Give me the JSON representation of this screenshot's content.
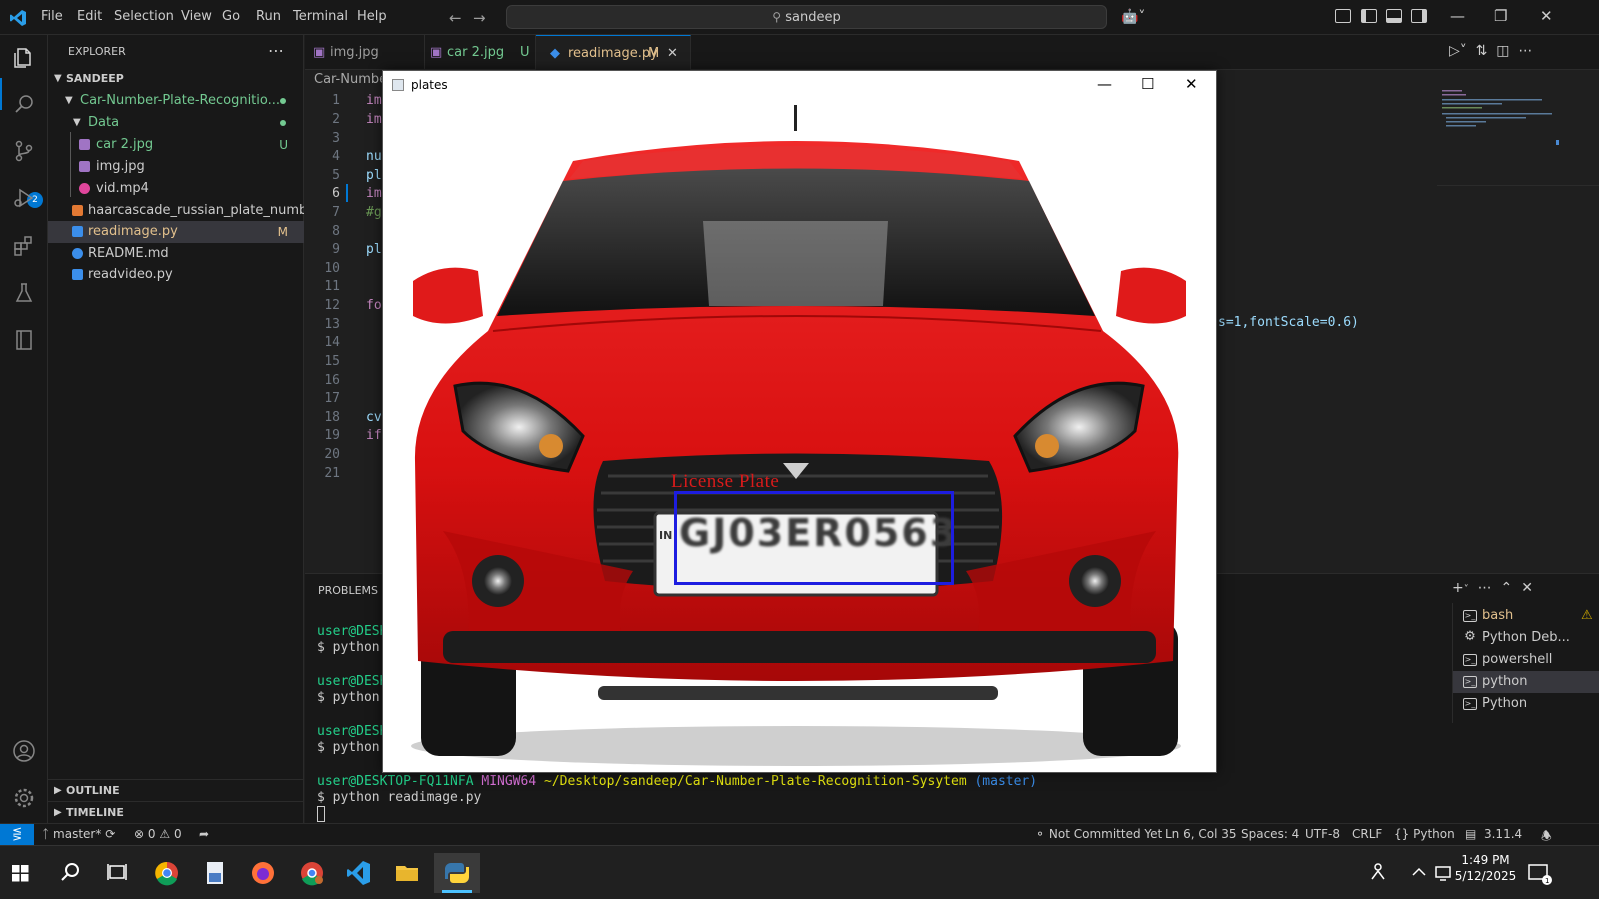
{
  "menu": [
    "File",
    "Edit",
    "Selection",
    "View",
    "Go",
    "Run",
    "Terminal",
    "Help"
  ],
  "search": {
    "text": "sandeep"
  },
  "explorer": {
    "title": "EXPLORER",
    "root": "SANDEEP",
    "folder": "Car-Number-Plate-Recognitio...",
    "subfolder": "Data",
    "files": [
      {
        "name": "car 2.jpg",
        "decoration": "U"
      },
      {
        "name": "img.jpg",
        "decoration": ""
      },
      {
        "name": "vid.mp4",
        "decoration": ""
      },
      {
        "name": "haarcascade_russian_plate_number....",
        "decoration": ""
      },
      {
        "name": "readimage.py",
        "decoration": "M"
      },
      {
        "name": "README.md",
        "decoration": ""
      },
      {
        "name": "readvideo.py",
        "decoration": ""
      }
    ],
    "outline": "OUTLINE",
    "timeline": "TIMELINE"
  },
  "scm_badge": "2",
  "tabs": [
    {
      "label": "img.jpg",
      "dec": ""
    },
    {
      "label": "car 2.jpg",
      "dec": "U"
    },
    {
      "label": "readimage.py",
      "dec": "M"
    }
  ],
  "breadcrumb": "Car-Numbe",
  "code_lines": [
    {
      "n": "1",
      "t": "im"
    },
    {
      "n": "2",
      "t": "im"
    },
    {
      "n": "3",
      "t": ""
    },
    {
      "n": "4",
      "t": "nu"
    },
    {
      "n": "5",
      "t": "pl"
    },
    {
      "n": "6",
      "t": "im"
    },
    {
      "n": "7",
      "t": "#g"
    },
    {
      "n": "8",
      "t": ""
    },
    {
      "n": "9",
      "t": "pl"
    },
    {
      "n": "10",
      "t": ""
    },
    {
      "n": "11",
      "t": ""
    },
    {
      "n": "12",
      "t": "fo"
    },
    {
      "n": "13",
      "t": ""
    },
    {
      "n": "14",
      "t": ""
    },
    {
      "n": "15",
      "t": ""
    },
    {
      "n": "16",
      "t": ""
    },
    {
      "n": "17",
      "t": ""
    },
    {
      "n": "18",
      "t": "cv"
    },
    {
      "n": "19",
      "t": "if"
    },
    {
      "n": "20",
      "t": ""
    },
    {
      "n": "21",
      "t": ""
    }
  ],
  "code_fragment": "s=1,fontScale=0.6)",
  "panel": {
    "title": "PROBLEMS",
    "terminal_lines": [
      {
        "user": "user@DESK",
        "cmd": "$ python r"
      },
      {
        "user": "user@DESK",
        "cmd": "$ python r"
      },
      {
        "user": "user@DESK",
        "cmd": "$ python r"
      }
    ],
    "prompt_user": "user@DESKTOP-FQ11NFA",
    "prompt_shell": "MINGW64",
    "prompt_path": "~/Desktop/sandeep/Car-Number-Plate-Recognition-Sysytem",
    "prompt_branch": "(master)",
    "last_cmd": "$ python readimage.py",
    "terminals": [
      "bash",
      "Python Deb...",
      "powershell",
      "python",
      "Python"
    ]
  },
  "status": {
    "branch": "master*",
    "errors": "0",
    "warnings": "0",
    "commit": "Not Committed Yet",
    "position": "Ln 6, Col 35",
    "spaces": "Spaces: 4",
    "encoding": "UTF-8",
    "eol": "CRLF",
    "language": "Python",
    "version": "3.11.4"
  },
  "plates_window": {
    "title": "plates",
    "label": "License Plate",
    "plate": "GJ03ER0563",
    "plate_side": "IN"
  },
  "clock": {
    "time": "1:49 PM",
    "date": "5/12/2025"
  },
  "colors": {
    "accent": "#0078d4",
    "bbox": "#1d1de0",
    "label": "#d81b1b",
    "car": "#e01010"
  }
}
